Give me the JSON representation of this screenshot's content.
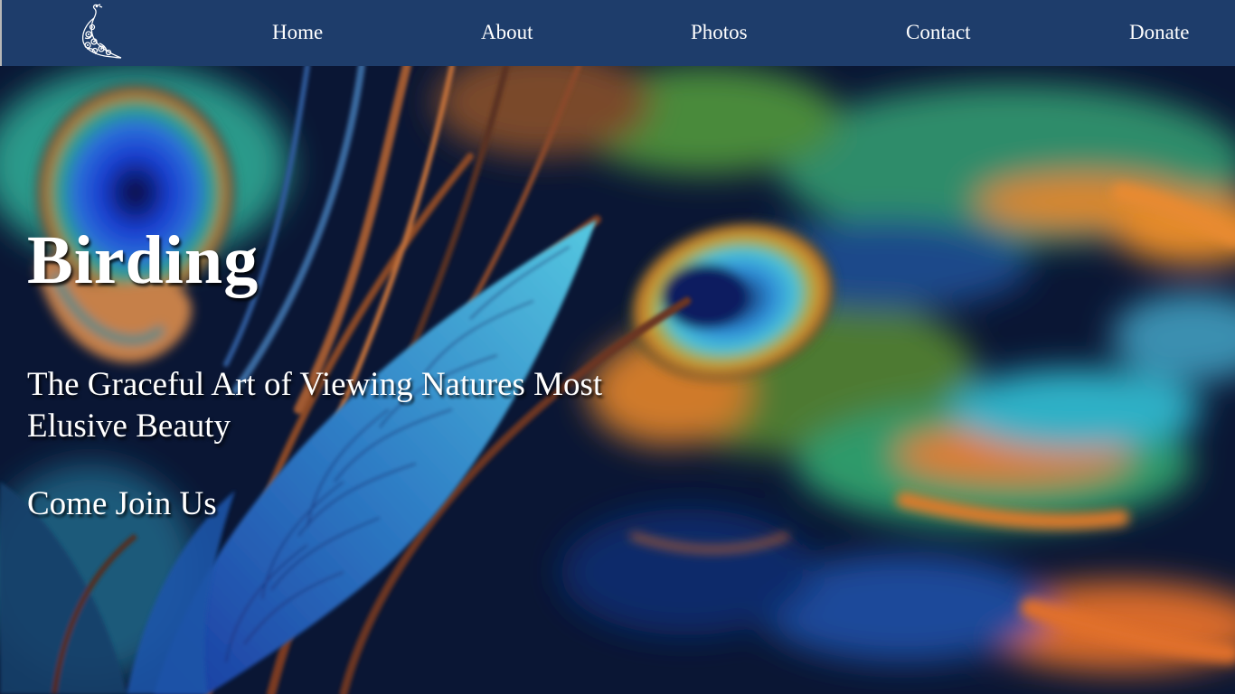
{
  "nav": {
    "logo_icon": "peacock-icon",
    "items": [
      {
        "label": "Home"
      },
      {
        "label": "About"
      },
      {
        "label": "Photos"
      },
      {
        "label": "Contact"
      },
      {
        "label": "Donate"
      }
    ]
  },
  "hero": {
    "title": "Birding",
    "subtitle": "The Graceful Art of Viewing Natures Most Elusive Beauty",
    "cta": "Come Join Us",
    "background": "peacock-feathers-image"
  },
  "colors": {
    "nav_bg": "#1e3d6b",
    "text": "#ffffff"
  }
}
